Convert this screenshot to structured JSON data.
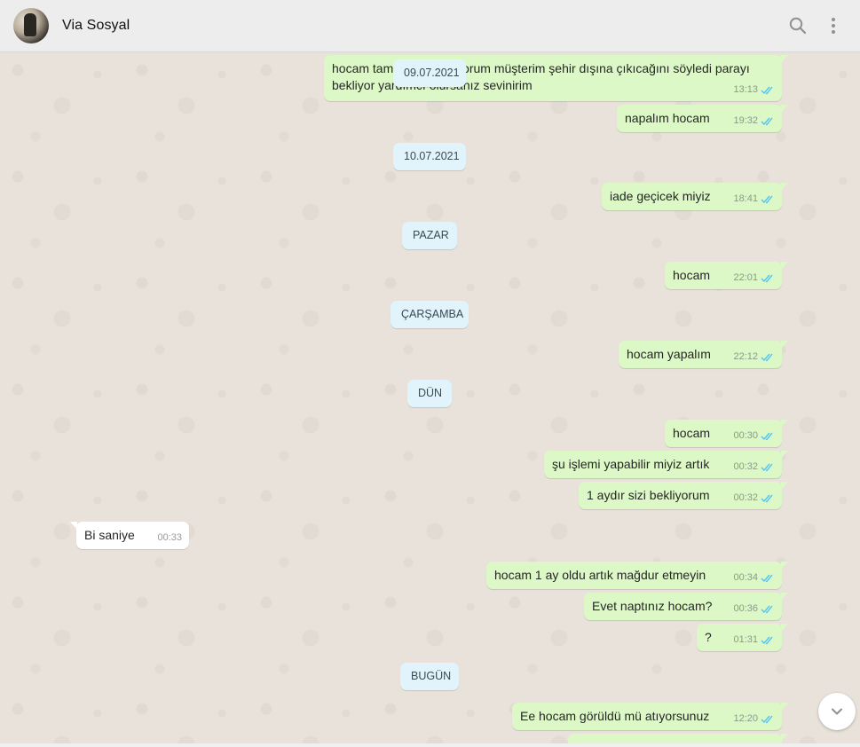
{
  "header": {
    "contact_name": "Via Sosyal",
    "avatar_icon": "contact-avatar",
    "search_icon": "search-icon",
    "menu_icon": "more-vertical-icon"
  },
  "messages": [
    {
      "dir": "out",
      "text": "hocam tamam iade istiyorum müşterim şehir dışına çıkıcağını söyledi parayı bekliyor yardımcı olursanız sevinirim",
      "time": "13:13",
      "ticks": "read"
    },
    {
      "dir": "out",
      "text": "napalım hocam",
      "time": "19:32",
      "ticks": "read"
    },
    {
      "dir": "out",
      "text": "iade geçicek miyiz",
      "time": "18:41",
      "ticks": "read"
    },
    {
      "dir": "out",
      "text": "hocam",
      "time": "22:01",
      "ticks": "read"
    },
    {
      "dir": "out",
      "text": "hocam yapalım",
      "time": "22:12",
      "ticks": "read"
    },
    {
      "dir": "out",
      "text": "hocam",
      "time": "00:30",
      "ticks": "read"
    },
    {
      "dir": "out",
      "text": "şu işlemi yapabilir miyiz artık",
      "time": "00:32",
      "ticks": "read"
    },
    {
      "dir": "out",
      "text": "1 aydır sizi bekliyorum",
      "time": "00:32",
      "ticks": "read"
    },
    {
      "dir": "in",
      "text": "Bi saniye",
      "time": "00:33"
    },
    {
      "dir": "out",
      "text": "hocam 1 ay oldu artık mağdur etmeyin",
      "time": "00:34",
      "ticks": "read"
    },
    {
      "dir": "out",
      "text": "Evet naptınız hocam?",
      "time": "00:36",
      "ticks": "read"
    },
    {
      "dir": "out",
      "text": "?",
      "time": "01:31",
      "ticks": "read"
    },
    {
      "dir": "out",
      "text": "Ee hocam görüldü mü atıyorsunuz",
      "time": "12:20",
      "ticks": "read"
    }
  ],
  "date_separators": [
    "09.07.2021",
    "10.07.2021",
    "PAZAR",
    "ÇARŞAMBA",
    "DÜN",
    "BUGÜN"
  ],
  "scroll_button_icon": "chevron-down-icon",
  "colors": {
    "outgoing_bubble": "#dcf8c6",
    "incoming_bubble": "#ffffff",
    "date_pill": "#e1f3fb",
    "read_ticks": "#4fc3f7",
    "header_bg": "#ededed"
  }
}
